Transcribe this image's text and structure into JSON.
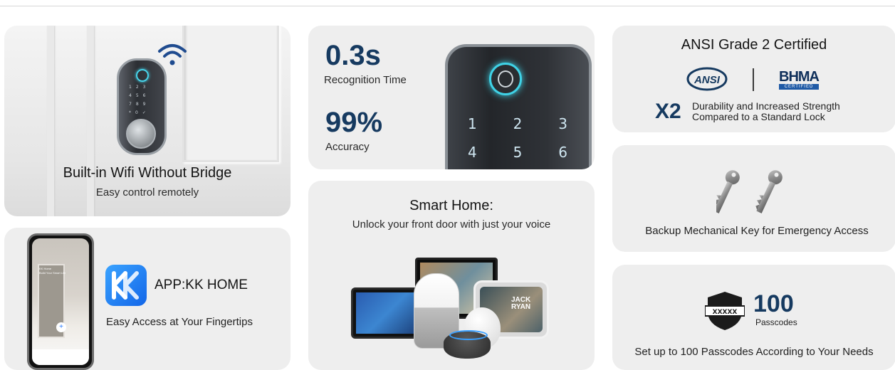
{
  "wifi_card": {
    "title": "Built-in Wifi Without Bridge",
    "subtitle": "Easy control remotely"
  },
  "app_card": {
    "app_name": "APP:KK HOME",
    "subtitle": "Easy Access at Your Fingertips",
    "phone_text": "KK Home\nBuild Your Smart Life",
    "phone_button": "+"
  },
  "recognition_card": {
    "time_value": "0.3s",
    "time_label": "Recognition Time",
    "accuracy_value": "99%",
    "accuracy_label": "Accuracy",
    "keypad_rows": [
      [
        "1",
        "2",
        "3"
      ],
      [
        "4",
        "5",
        "6"
      ]
    ]
  },
  "smart_home_card": {
    "title": "Smart Home:",
    "subtitle": "Unlock your front door with just your voice",
    "device_text": "JACK RYAN"
  },
  "ansi_card": {
    "title": "ANSI Grade 2 Certified",
    "ansi_logo": "ANSI",
    "bhma_logo": "BHMA",
    "bhma_tag": "CERTIFIED",
    "multiplier": "X2",
    "multiplier_text_1": "Durability and Increased Strength",
    "multiplier_text_2": "Compared to a Standard Lock"
  },
  "keys_card": {
    "text": "Backup Mechanical Key for Emergency Access",
    "icon": "keys-icon"
  },
  "passcode_card": {
    "count": "100",
    "count_label": "Passcodes",
    "shield_text": "XXXXX",
    "text": "Set up to 100 Passcodes According to Your Needs"
  },
  "colors": {
    "accent_navy": "#163a60",
    "fingerprint_glow": "#3fd2e6",
    "card_bg": "#eeeeee"
  }
}
